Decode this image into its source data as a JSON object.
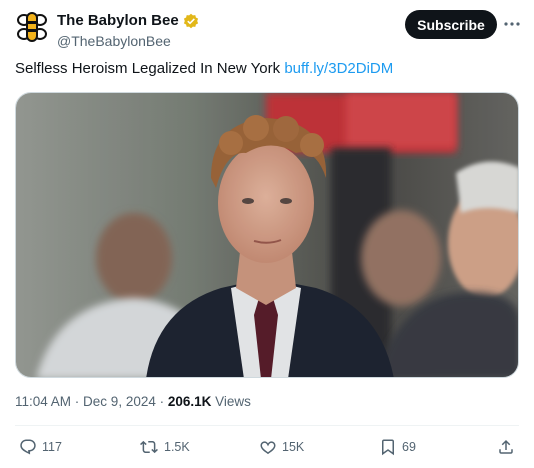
{
  "author": {
    "name": "The Babylon Bee",
    "handle": "@TheBabylonBee",
    "verified_badge_color": "#e2b719",
    "avatar_icon": "bee-logo-icon"
  },
  "subscribe_label": "Subscribe",
  "tweet": {
    "text": "Selfless Heroism Legalized In New York",
    "link_text": "buff.ly/3D2DiDM"
  },
  "meta": {
    "time": "11:04 AM",
    "separator": " · ",
    "date": "Dec 9, 2024",
    "separator2": " · ",
    "views_count": "206.1K",
    "views_label": " Views"
  },
  "actions": {
    "replies": "117",
    "reposts": "1.5K",
    "likes": "15K",
    "bookmarks": "69"
  },
  "colors": {
    "link": "#1d9bf0",
    "text": "#0f1419",
    "secondary": "#536471"
  }
}
